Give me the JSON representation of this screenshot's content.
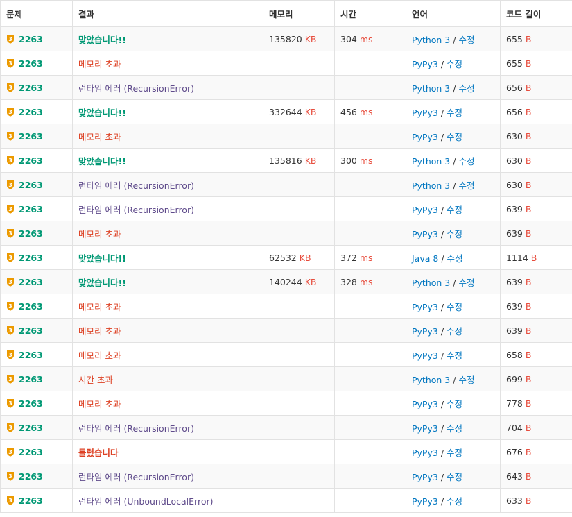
{
  "headers": {
    "problem": "문제",
    "result": "결과",
    "memory": "메모리",
    "time": "시간",
    "language": "언어",
    "code_length": "코드 길이"
  },
  "units": {
    "memory": "KB",
    "time": "ms",
    "length": "B"
  },
  "edit_label": "수정",
  "tier_badge": "3",
  "rows": [
    {
      "problem": "2263",
      "result": "맞았습니다!!",
      "status": "ac",
      "memory": "135820",
      "time": "304",
      "language": "Python 3",
      "length": "655"
    },
    {
      "problem": "2263",
      "result": "메모리 초과",
      "status": "mle",
      "memory": "",
      "time": "",
      "language": "PyPy3",
      "length": "655"
    },
    {
      "problem": "2263",
      "result": "런타임 에러 (RecursionError)",
      "status": "rte",
      "memory": "",
      "time": "",
      "language": "Python 3",
      "length": "656"
    },
    {
      "problem": "2263",
      "result": "맞았습니다!!",
      "status": "ac",
      "memory": "332644",
      "time": "456",
      "language": "PyPy3",
      "length": "656"
    },
    {
      "problem": "2263",
      "result": "메모리 초과",
      "status": "mle",
      "memory": "",
      "time": "",
      "language": "PyPy3",
      "length": "630"
    },
    {
      "problem": "2263",
      "result": "맞았습니다!!",
      "status": "ac",
      "memory": "135816",
      "time": "300",
      "language": "Python 3",
      "length": "630"
    },
    {
      "problem": "2263",
      "result": "런타임 에러 (RecursionError)",
      "status": "rte",
      "memory": "",
      "time": "",
      "language": "Python 3",
      "length": "630"
    },
    {
      "problem": "2263",
      "result": "런타임 에러 (RecursionError)",
      "status": "rte",
      "memory": "",
      "time": "",
      "language": "PyPy3",
      "length": "639"
    },
    {
      "problem": "2263",
      "result": "메모리 초과",
      "status": "mle",
      "memory": "",
      "time": "",
      "language": "PyPy3",
      "length": "639"
    },
    {
      "problem": "2263",
      "result": "맞았습니다!!",
      "status": "ac",
      "memory": "62532",
      "time": "372",
      "language": "Java 8",
      "length": "1114"
    },
    {
      "problem": "2263",
      "result": "맞았습니다!!",
      "status": "ac",
      "memory": "140244",
      "time": "328",
      "language": "Python 3",
      "length": "639"
    },
    {
      "problem": "2263",
      "result": "메모리 초과",
      "status": "mle",
      "memory": "",
      "time": "",
      "language": "PyPy3",
      "length": "639"
    },
    {
      "problem": "2263",
      "result": "메모리 초과",
      "status": "mle",
      "memory": "",
      "time": "",
      "language": "PyPy3",
      "length": "639"
    },
    {
      "problem": "2263",
      "result": "메모리 초과",
      "status": "mle",
      "memory": "",
      "time": "",
      "language": "PyPy3",
      "length": "658"
    },
    {
      "problem": "2263",
      "result": "시간 초과",
      "status": "tle",
      "memory": "",
      "time": "",
      "language": "Python 3",
      "length": "699"
    },
    {
      "problem": "2263",
      "result": "메모리 초과",
      "status": "mle",
      "memory": "",
      "time": "",
      "language": "PyPy3",
      "length": "778"
    },
    {
      "problem": "2263",
      "result": "런타임 에러 (RecursionError)",
      "status": "rte",
      "memory": "",
      "time": "",
      "language": "PyPy3",
      "length": "704"
    },
    {
      "problem": "2263",
      "result": "틀렸습니다",
      "status": "wa",
      "memory": "",
      "time": "",
      "language": "PyPy3",
      "length": "676"
    },
    {
      "problem": "2263",
      "result": "런타임 에러 (RecursionError)",
      "status": "rte",
      "memory": "",
      "time": "",
      "language": "PyPy3",
      "length": "643"
    },
    {
      "problem": "2263",
      "result": "런타임 에러 (UnboundLocalError)",
      "status": "rte",
      "memory": "",
      "time": "",
      "language": "PyPy3",
      "length": "633"
    }
  ],
  "colors": {
    "accepted": "#009874",
    "memory_exceeded": "#dd4124",
    "runtime_error": "#5f4b8b",
    "unit": "#e74c3c",
    "link": "#0076c0",
    "tier_gold": "#ec9a00"
  }
}
